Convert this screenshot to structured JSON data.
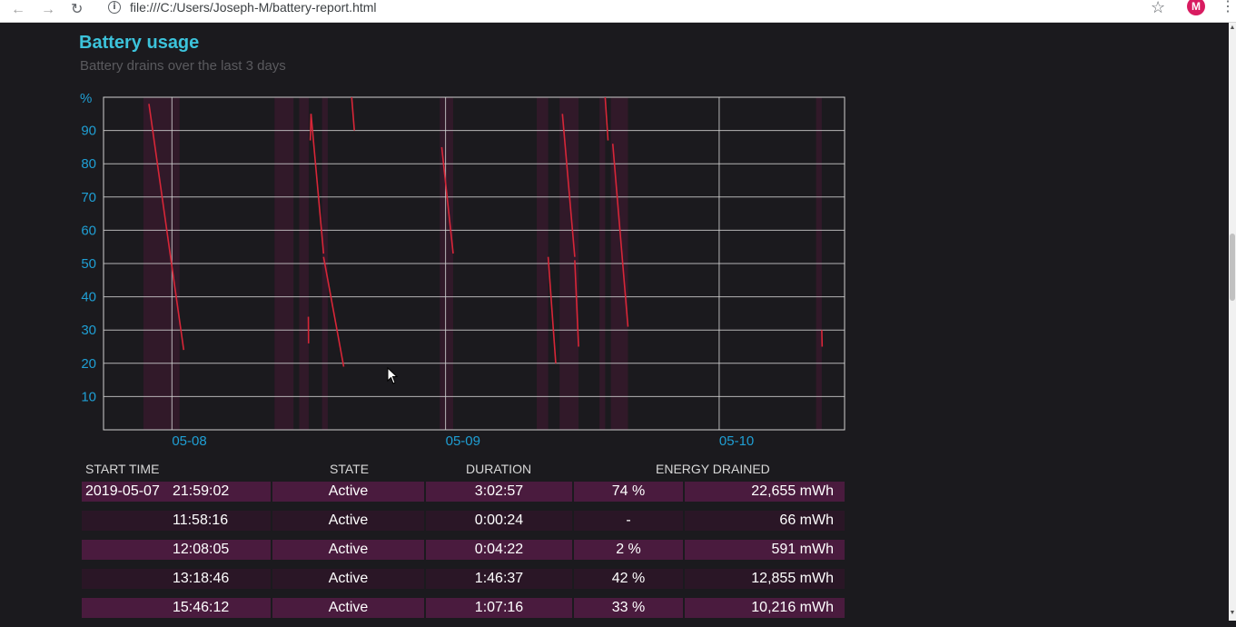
{
  "browser": {
    "url": "file:///C:/Users/Joseph-M/battery-report.html",
    "avatar_letter": "M",
    "back_icon": "arrow-left-icon",
    "forward_icon": "arrow-right-icon",
    "reload_icon": "reload-icon",
    "info_glyph": "i"
  },
  "section": {
    "title": "Battery usage",
    "subtitle": "Battery drains over the last 3 days"
  },
  "chart_data": {
    "type": "line",
    "ylabel": "%",
    "ylim": [
      0,
      100
    ],
    "y_ticks": [
      10,
      20,
      30,
      40,
      50,
      60,
      70,
      80,
      90
    ],
    "x_tick_labels": [
      "05-08",
      "05-09",
      "05-10"
    ],
    "xlim": [
      "2019-05-07 18:00",
      "2019-05-10 11:00"
    ],
    "grid": true,
    "colors": {
      "drain": "#d72638",
      "active_band": "#3a1a2e",
      "axis_text": "#1f9fd4",
      "grid": "#d0d0d0"
    },
    "active_periods": [
      [
        "2019-05-07 21:30",
        "2019-05-08 00:40"
      ],
      [
        "2019-05-08 09:00",
        "2019-05-08 10:40"
      ],
      [
        "2019-05-08 11:10",
        "2019-05-08 12:00"
      ],
      [
        "2019-05-08 13:10",
        "2019-05-08 13:40"
      ],
      [
        "2019-05-08 23:30",
        "2019-05-09 00:40"
      ],
      [
        "2019-05-09 08:00",
        "2019-05-09 09:00"
      ],
      [
        "2019-05-09 10:00",
        "2019-05-09 11:40"
      ],
      [
        "2019-05-09 13:30",
        "2019-05-09 14:00"
      ],
      [
        "2019-05-09 14:30",
        "2019-05-09 16:00"
      ],
      [
        "2019-05-10 08:30",
        "2019-05-10 09:00"
      ]
    ],
    "drains": [
      [
        [
          "2019-05-07 21:59",
          98
        ],
        [
          "2019-05-08 01:02",
          24
        ]
      ],
      [
        [
          "2019-05-08 11:58",
          34
        ],
        [
          "2019-05-08 11:59",
          26
        ]
      ],
      [
        [
          "2019-05-08 12:08",
          87
        ],
        [
          "2019-05-08 12:12",
          95
        ]
      ],
      [
        [
          "2019-05-08 12:12",
          95
        ],
        [
          "2019-05-08 13:18",
          53
        ]
      ],
      [
        [
          "2019-05-08 13:18",
          52
        ],
        [
          "2019-05-08 15:04",
          19
        ]
      ],
      [
        [
          "2019-05-08 15:46",
          100
        ],
        [
          "2019-05-08 16:00",
          90
        ]
      ],
      [
        [
          "2019-05-08 23:40",
          85
        ],
        [
          "2019-05-09 00:40",
          53
        ]
      ],
      [
        [
          "2019-05-09 09:00",
          52
        ],
        [
          "2019-05-09 09:40",
          20
        ]
      ],
      [
        [
          "2019-05-09 10:15",
          95
        ],
        [
          "2019-05-09 11:20",
          52
        ]
      ],
      [
        [
          "2019-05-09 11:20",
          51
        ],
        [
          "2019-05-09 11:40",
          25
        ]
      ],
      [
        [
          "2019-05-09 14:00",
          100
        ],
        [
          "2019-05-09 14:15",
          87
        ]
      ],
      [
        [
          "2019-05-09 14:40",
          86
        ],
        [
          "2019-05-09 16:00",
          31
        ]
      ],
      [
        [
          "2019-05-10 09:00",
          30
        ],
        [
          "2019-05-10 09:02",
          25
        ]
      ]
    ]
  },
  "table": {
    "headers": [
      "START TIME",
      "STATE",
      "DURATION",
      "ENERGY DRAINED"
    ],
    "rows": [
      {
        "date": "2019-05-07",
        "time": "21:59:02",
        "state": "Active",
        "duration": "3:02:57",
        "percent": "74 %",
        "energy": "22,655 mWh"
      },
      {
        "date": "",
        "time": "11:58:16",
        "state": "Active",
        "duration": "0:00:24",
        "percent": "-",
        "energy": "66 mWh"
      },
      {
        "date": "",
        "time": "12:08:05",
        "state": "Active",
        "duration": "0:04:22",
        "percent": "2 %",
        "energy": "591 mWh"
      },
      {
        "date": "",
        "time": "13:18:46",
        "state": "Active",
        "duration": "1:46:37",
        "percent": "42 %",
        "energy": "12,855 mWh"
      },
      {
        "date": "",
        "time": "15:46:12",
        "state": "Active",
        "duration": "1:07:16",
        "percent": "33 %",
        "energy": "10,216 mWh"
      }
    ]
  }
}
